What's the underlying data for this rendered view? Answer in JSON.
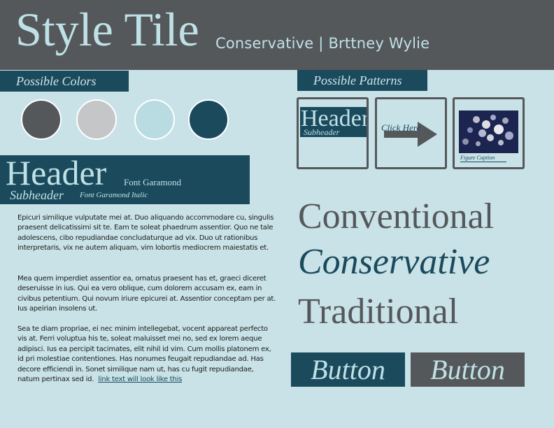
{
  "header": {
    "title": "Style Tile",
    "subtitle": "Conservative | Brttney Wylie"
  },
  "colors": {
    "label": "Possible Colors",
    "swatches": [
      {
        "name": "dark-gray",
        "hex": "#55585b"
      },
      {
        "name": "light-gray",
        "hex": "#c5c6c7"
      },
      {
        "name": "light-blue",
        "hex": "#b9dce2"
      },
      {
        "name": "dark-teal",
        "hex": "#1b4a5d"
      }
    ]
  },
  "typography": {
    "header": "Header",
    "header_font": "Font Garamond",
    "subheader": "Subheader",
    "subheader_font": "Font Garamond Italic"
  },
  "body_text": {
    "paragraph1": "Epicuri similique vulputate mei at. Duo aliquando accommodare cu, singulis praesent delicatissimi sit te. Eam te soleat phaedrum assentior. Quo ne tale adolescens, cibo repudiandae concludaturque ad vix. Duo ut rationibus interpretaris, vix ne autem aliquam, vim lobortis mediocrem maiestatis et.",
    "paragraph2": "Mea quem imperdiet assentior ea, ornatus praesent has et, graeci diceret deseruisse in ius. Qui ea vero oblique, cum dolorem accusam ex, eam in civibus petentium. Qui novum iriure epicurei at. Assentior conceptam per at. Ius apeirian insolens ut.",
    "paragraph3": "Sea te diam propriae, ei nec minim intellegebat, vocent appareat perfecto vis at. Ferri voluptua his te, soleat maluisset mei no, sed ex lorem aeque adipisci. Ius ea percipit tacimates, elit nihil id vim. Cum mollis platonem ex, id pri molestiae contentiones. Has nonumes feugait repudiandae ad. Has decore efficiendi in. Sonet similique nam ut, has cu fugit repudiandae, natum pertinax sed id.",
    "link_text": "link text will look like this"
  },
  "patterns": {
    "label": "Possible Patterns",
    "tile_header": "Header",
    "tile_subheader": "Subheader",
    "click_here": "Click Here",
    "figure_caption": "Figure Caption"
  },
  "keywords": [
    "Conventional",
    "Conservative",
    "Traditional"
  ],
  "buttons": {
    "primary_label": "Button",
    "secondary_label": "Button"
  }
}
